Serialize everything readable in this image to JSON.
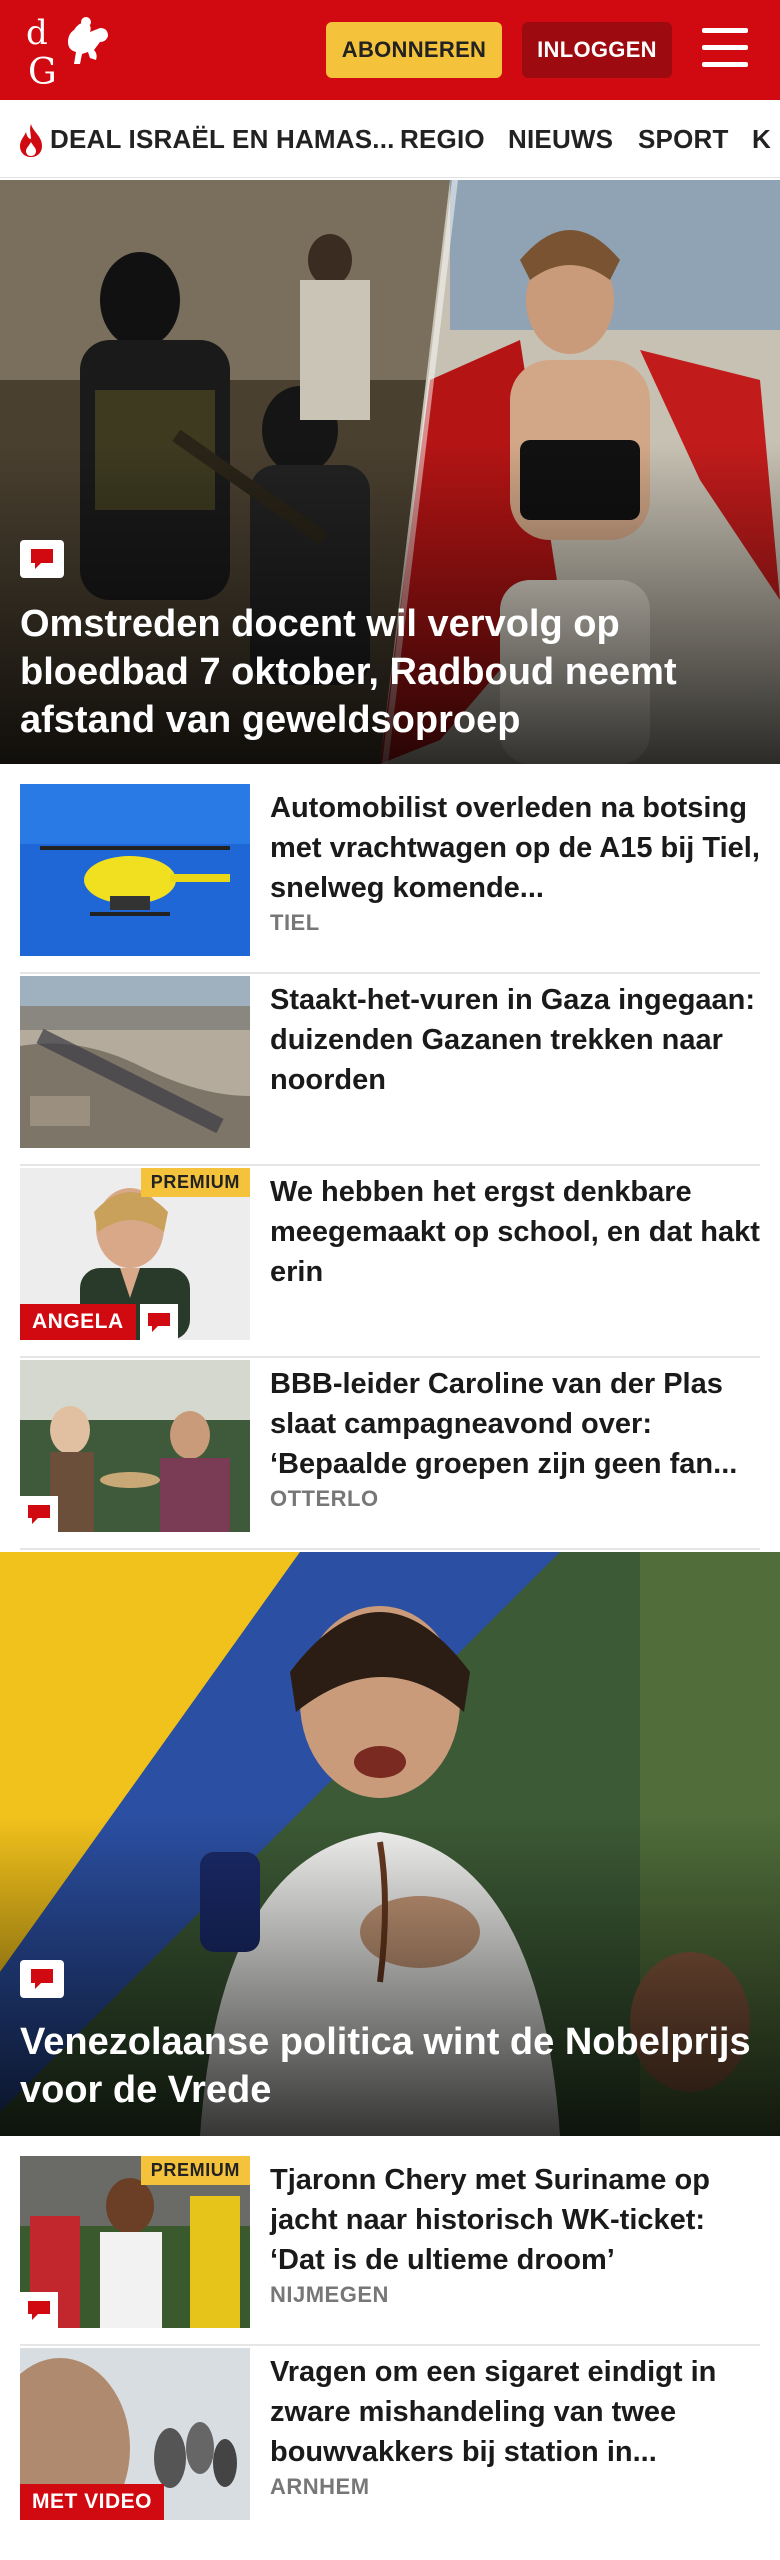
{
  "header": {
    "logo_text": "dG",
    "subscribe_label": "ABONNEREN",
    "login_label": "INLOGGEN",
    "colors": {
      "brand": "#d10a11",
      "subscribe": "#f5c23b",
      "login": "#9d0a10"
    }
  },
  "nav": {
    "items": [
      "DEAL ISRAËL EN HAMAS...",
      "REGIO",
      "NIEUWS",
      "SPORT",
      "K"
    ]
  },
  "hero1": {
    "title": "Omstreden docent wil vervolg op bloedbad 7 oktober, Radboud neemt afstand van geweldsoproep"
  },
  "articles1": [
    {
      "title": "Automobilist overleden na botsing met vrachtwagen op de A15 bij Tiel, snelweg komende...",
      "location": "TIEL"
    },
    {
      "title": "Staakt-het-vuren in Gaza ingegaan: duizenden Gazanen trekken naar noorden",
      "location": ""
    },
    {
      "title": "We hebben het ergst denkbare meegemaakt op school, en dat hakt erin",
      "premium": "PREMIUM",
      "label": "ANGELA"
    },
    {
      "title": "BBB-leider Caroline van der Plas slaat campagneavond over: ‘Bepaalde groepen zijn geen fan...",
      "location": "OTTERLO"
    }
  ],
  "hero2": {
    "title": "Venezolaanse politica wint de Nobelprijs voor de Vrede"
  },
  "articles2": [
    {
      "title": "Tjaronn Chery met Suriname op jacht naar historisch WK-ticket: ‘Dat is de ultieme droom’",
      "location": "NIJMEGEN",
      "premium": "PREMIUM"
    },
    {
      "title": "Vragen om een sigaret eindigt in zware mishandeling van twee bouwvakkers bij station in...",
      "location": "ARNHEM",
      "label": "MET VIDEO"
    }
  ]
}
